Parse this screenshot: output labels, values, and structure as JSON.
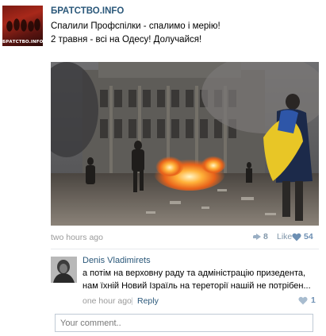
{
  "post": {
    "group_name": "БРАТСТВО.INFO",
    "avatar_caption": "БРАТСТВО.INFO",
    "text_line1": "Спалили Профспілки - спалимо і мерію!",
    "text_line2": "2 травня - всі на Одесу! Долучайся!",
    "photo_icon": "photo-of-burning-building",
    "time": "two hours ago",
    "repost_count": "8",
    "like_label": "Like",
    "like_count": "54"
  },
  "comment": {
    "author": "Denis Vladimirets",
    "text_line1": "а потім на верховну раду та адміністрацію призедента,",
    "text_line2": "нам їхній Новий Ізраїль на теpеторії нашій не потрібен...",
    "time": "one hour ago",
    "separator": "|",
    "reply_label": "Reply",
    "like_count": "1"
  },
  "input": {
    "placeholder": "Your comment.."
  },
  "colors": {
    "link": "#2b587a",
    "muted": "#9a9a9a",
    "like_blue": "#6d8fb3"
  }
}
